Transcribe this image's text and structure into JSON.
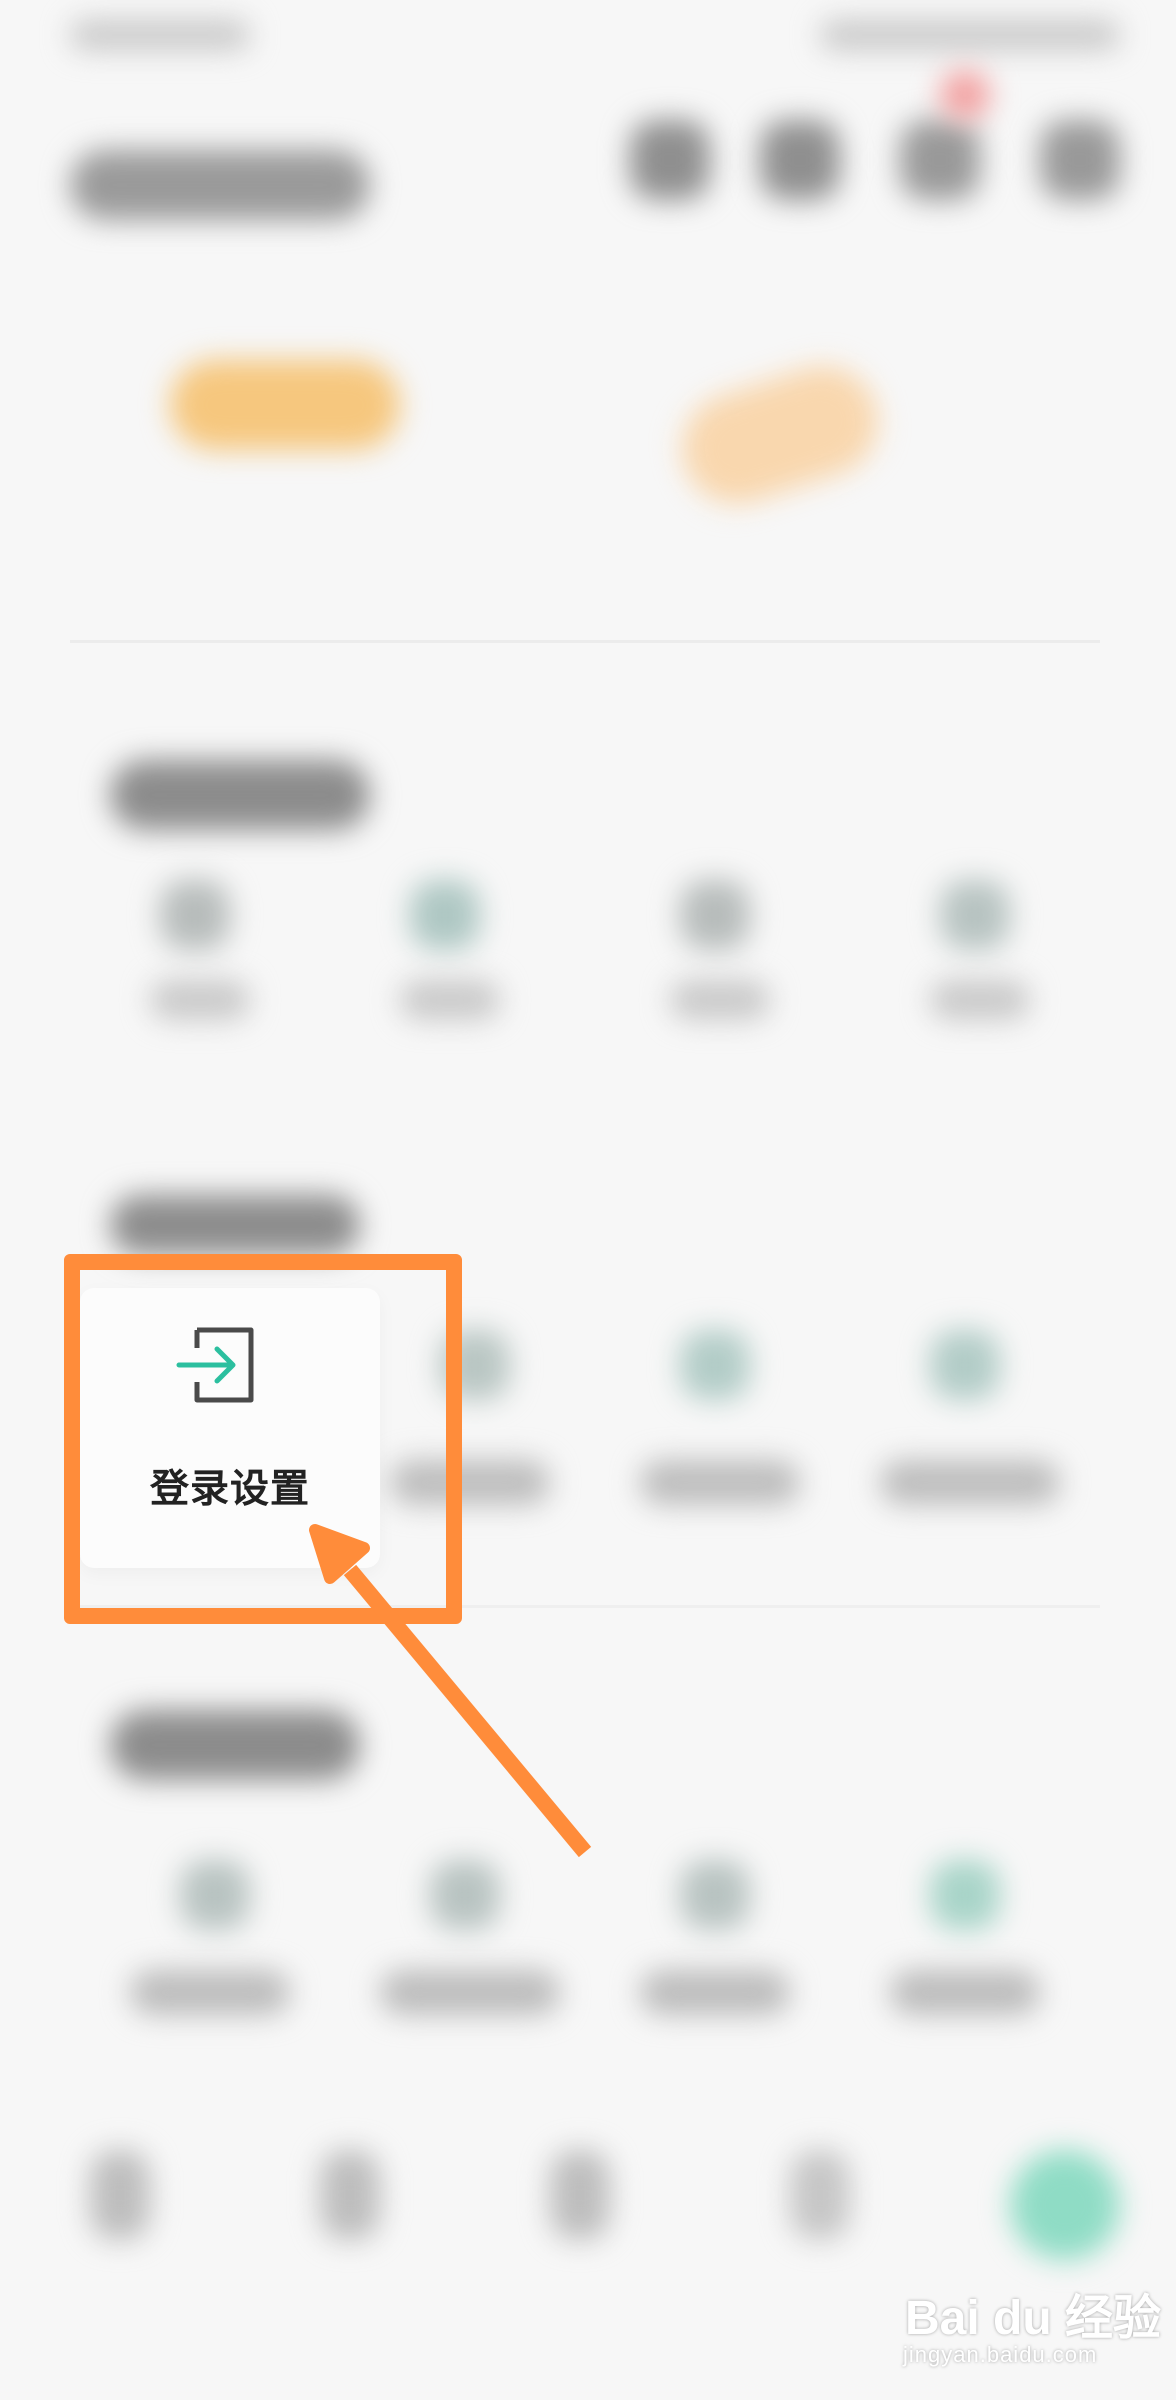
{
  "focused_item": {
    "label": "登录设置",
    "icon": "login-icon",
    "icon_colors": {
      "arrow": "#2bbf9f",
      "frame": "#4a4a4a"
    }
  },
  "annotation": {
    "color": "#ff8c3a"
  },
  "watermark": {
    "brand": "Bai du 经验",
    "url": "jingyan.baidu.com"
  }
}
